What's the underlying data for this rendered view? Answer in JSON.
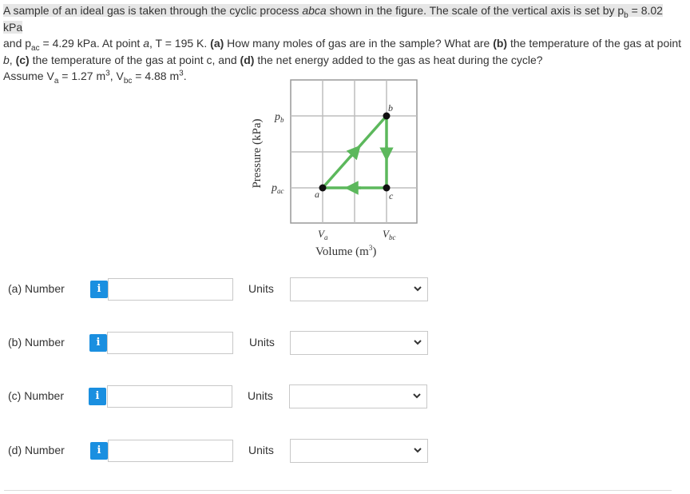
{
  "problem": {
    "s1": "A sample of an ideal gas is taken through the cyclic process ",
    "s1_it": "abca",
    "s2": " shown in the figure. The scale of the vertical axis is set by p",
    "s2_sub": "b",
    "s3": " = 8.02 kPa",
    "s4": "and p",
    "s4_sub": "ac",
    "s5": " = 4.29 kPa. At point ",
    "s5_it": "a",
    "s6": ", T = 195 K. ",
    "s6_b": "(a)",
    "s7": " How many moles of gas are in the sample? What are ",
    "s7_b": "(b)",
    "s8": " the temperature of the gas at point",
    "s9_it": "b",
    "s9": ", ",
    "s9_b": "(c)",
    "s10": " the temperature of the gas at point c, and ",
    "s10_b": "(d)",
    "s11": " the net energy added to the gas as heat during the cycle?",
    "s12": "Assume V",
    "s12_sub": "a",
    "s13": " = 1.27 m",
    "s13_sup": "3",
    "s14": ", V",
    "s14_sub": "bc",
    "s15": " = 4.88 m",
    "s15_sup": "3",
    "s16": "."
  },
  "figure": {
    "ylabel": "Pressure (kPa)",
    "xlabel": "Volume (m",
    "xlabel_sup": "3",
    "xlabel_end": ")",
    "ytick_pb_main": "p",
    "ytick_pb_sub": "b",
    "ytick_pac_main": "p",
    "ytick_pac_sub": "ac",
    "xtick_va_main": "V",
    "xtick_va_sub": "a",
    "xtick_vbc_main": "V",
    "xtick_vbc_sub": "bc",
    "point_a": "a",
    "point_b": "b",
    "point_c": "c",
    "path_color": "#5cb85c"
  },
  "answers": [
    {
      "label": "(a)  Number",
      "info": "i",
      "value": "",
      "units_label": "Units",
      "units_value": ""
    },
    {
      "label": "(b)  Number",
      "info": "i",
      "value": "",
      "units_label": "Units",
      "units_value": ""
    },
    {
      "label": "(c)  Number",
      "info": "i",
      "value": "",
      "units_label": "Units",
      "units_value": ""
    },
    {
      "label": "(d)  Number",
      "info": "i",
      "value": "",
      "units_label": "Units",
      "units_value": ""
    }
  ]
}
